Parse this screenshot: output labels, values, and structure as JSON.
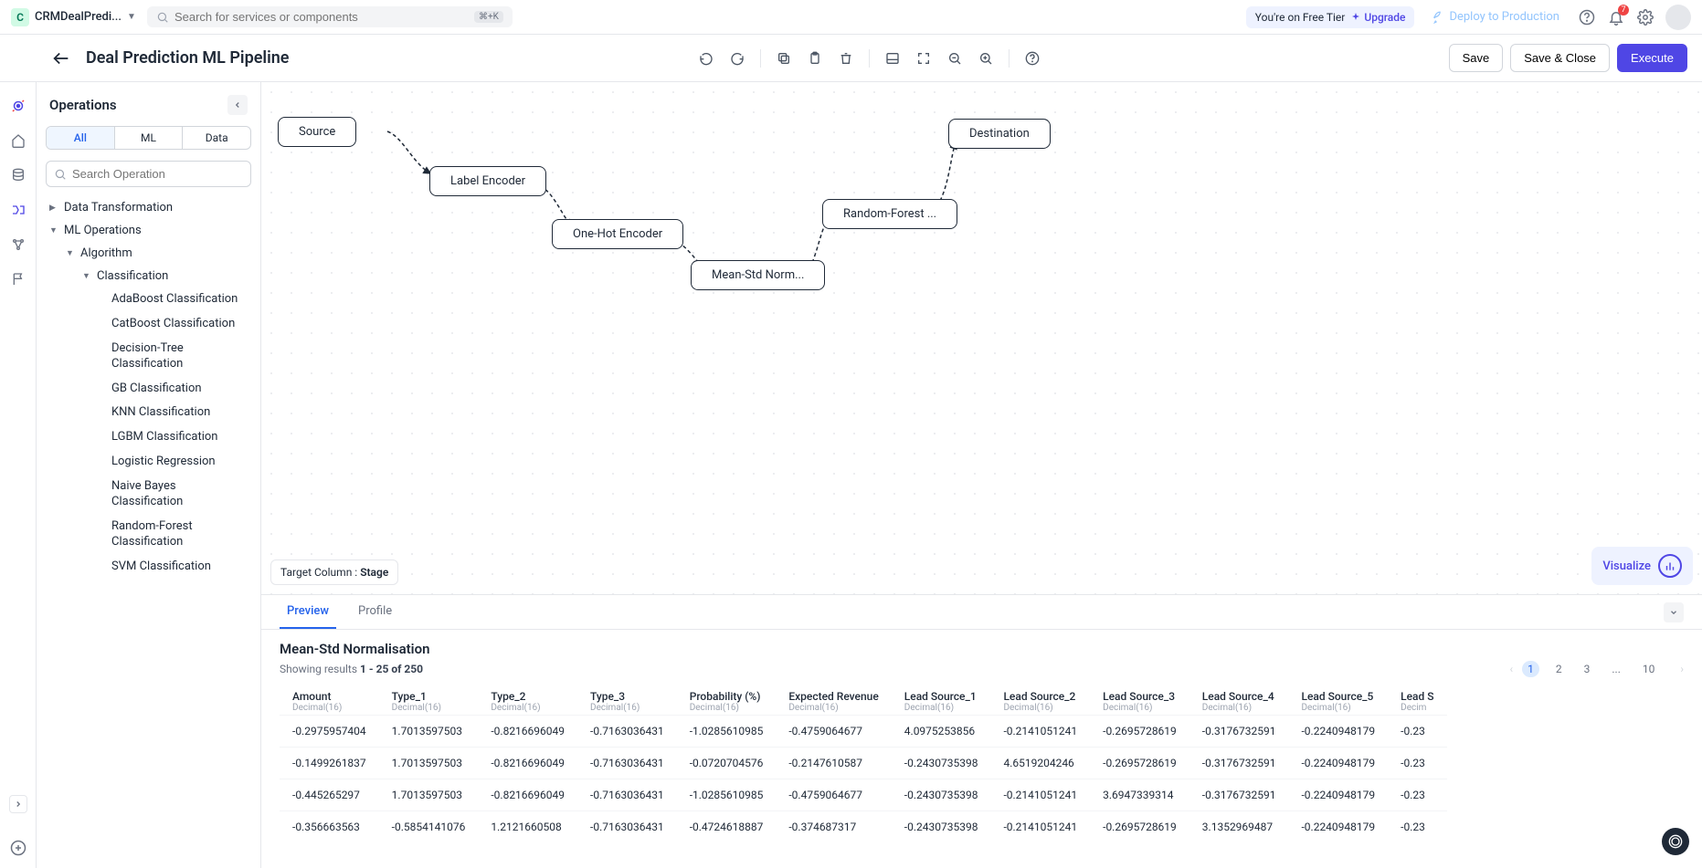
{
  "topbar": {
    "project_initial": "C",
    "project_name": "CRMDealPredi...",
    "search_placeholder": "Search for services or components",
    "search_shortcut": "⌘+K",
    "tier_text": "You're on Free Tier",
    "upgrade_label": "Upgrade",
    "deploy_label": "Deploy to Production",
    "notification_count": "7"
  },
  "header": {
    "title": "Deal Prediction ML Pipeline",
    "save_label": "Save",
    "save_close_label": "Save & Close",
    "execute_label": "Execute"
  },
  "sidebar": {
    "title": "Operations",
    "segments": [
      "All",
      "ML",
      "Data"
    ],
    "search_placeholder": "Search Operation",
    "tree": {
      "data_transformation": "Data Transformation",
      "ml_operations": "ML Operations",
      "algorithm": "Algorithm",
      "classification": "Classification",
      "leaves": [
        "AdaBoost Classification",
        "CatBoost Classification",
        "Decision-Tree Classification",
        "GB Classification",
        "KNN Classification",
        "LGBM Classification",
        "Logistic Regression",
        "Naive Bayes Classification",
        "Random-Forest Classification",
        "SVM Classification"
      ]
    }
  },
  "canvas": {
    "nodes": {
      "source": "Source",
      "label_encoder": "Label Encoder",
      "onehot": "One-Hot Encoder",
      "meanstd": "Mean-Std Norm...",
      "rf": "Random-Forest ...",
      "destination": "Destination"
    },
    "target_label": "Target Column :",
    "target_value": "Stage",
    "visualize_label": "Visualize"
  },
  "preview": {
    "tabs": [
      "Preview",
      "Profile"
    ],
    "title": "Mean-Std Normalisation",
    "results_prefix": "Showing results",
    "results_range": "1 - 25 of 250",
    "pages": [
      "1",
      "2",
      "3",
      "...",
      "10"
    ],
    "columns": [
      {
        "name": "Amount",
        "type": "Decimal(16)"
      },
      {
        "name": "Type_1",
        "type": "Decimal(16)"
      },
      {
        "name": "Type_2",
        "type": "Decimal(16)"
      },
      {
        "name": "Type_3",
        "type": "Decimal(16)"
      },
      {
        "name": "Probability (%)",
        "type": "Decimal(16)"
      },
      {
        "name": "Expected Revenue",
        "type": "Decimal(16)"
      },
      {
        "name": "Lead Source_1",
        "type": "Decimal(16)"
      },
      {
        "name": "Lead Source_2",
        "type": "Decimal(16)"
      },
      {
        "name": "Lead Source_3",
        "type": "Decimal(16)"
      },
      {
        "name": "Lead Source_4",
        "type": "Decimal(16)"
      },
      {
        "name": "Lead Source_5",
        "type": "Decimal(16)"
      },
      {
        "name": "Lead S",
        "type": "Decim"
      }
    ],
    "rows": [
      [
        "-0.2975957404",
        "1.7013597503",
        "-0.8216696049",
        "-0.7163036431",
        "-1.0285610985",
        "-0.4759064677",
        "4.0975253856",
        "-0.2141051241",
        "-0.2695728619",
        "-0.3176732591",
        "-0.2240948179",
        "-0.23"
      ],
      [
        "-0.1499261837",
        "1.7013597503",
        "-0.8216696049",
        "-0.7163036431",
        "-0.0720704576",
        "-0.2147610587",
        "-0.2430735398",
        "4.6519204246",
        "-0.2695728619",
        "-0.3176732591",
        "-0.2240948179",
        "-0.23"
      ],
      [
        "-0.445265297",
        "1.7013597503",
        "-0.8216696049",
        "-0.7163036431",
        "-1.0285610985",
        "-0.4759064677",
        "-0.2430735398",
        "-0.2141051241",
        "3.6947339314",
        "-0.3176732591",
        "-0.2240948179",
        "-0.23"
      ],
      [
        "-0.356663563",
        "-0.5854141076",
        "1.2121660508",
        "-0.7163036431",
        "-0.4724618887",
        "-0.374687317",
        "-0.2430735398",
        "-0.2141051241",
        "-0.2695728619",
        "3.1352969487",
        "-0.2240948179",
        "-0.23"
      ]
    ]
  }
}
